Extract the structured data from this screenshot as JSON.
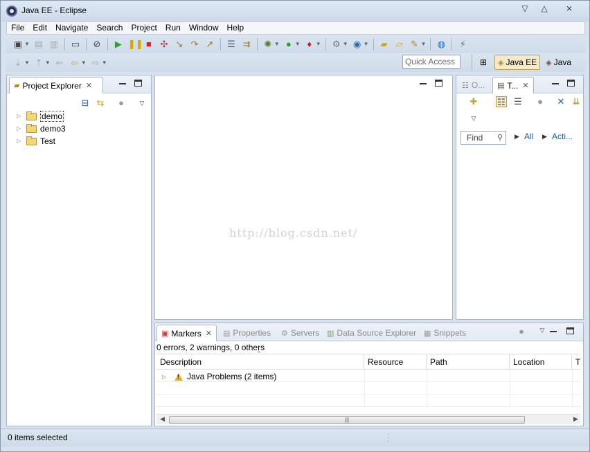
{
  "window": {
    "title": "Java EE - Eclipse",
    "controls": {
      "minimize": "▽",
      "maximize": "△",
      "close": "⨯"
    }
  },
  "menu": [
    "File",
    "Edit",
    "Navigate",
    "Search",
    "Project",
    "Run",
    "Window",
    "Help"
  ],
  "toolbar": {
    "quick_access": "Quick Access",
    "perspectives": [
      {
        "label": "Java EE",
        "icon": "java-ee-perspective-icon",
        "active": true
      },
      {
        "label": "Java",
        "icon": "java-perspective-icon",
        "active": false
      }
    ]
  },
  "project_explorer": {
    "tab_label": "Project Explorer",
    "items": [
      {
        "label": "demo",
        "selected": true
      },
      {
        "label": "demo3",
        "selected": false
      },
      {
        "label": "Test",
        "selected": false
      }
    ]
  },
  "editor": {
    "watermark": "http://blog.csdn.net/"
  },
  "side_panel": {
    "tabs": [
      "O...",
      "T..."
    ],
    "find_placeholder": "Find",
    "filter_all": "All",
    "filter_activate": "Acti..."
  },
  "bottom_panel": {
    "tabs": [
      {
        "label": "Markers",
        "active": true
      },
      {
        "label": "Properties",
        "active": false
      },
      {
        "label": "Servers",
        "active": false
      },
      {
        "label": "Data Source Explorer",
        "active": false
      },
      {
        "label": "Snippets",
        "active": false
      }
    ],
    "summary": "0 errors, 2 warnings, 0 others",
    "columns": [
      "Description",
      "Resource",
      "Path",
      "Location",
      "Ty"
    ],
    "rows": [
      {
        "description": "Java Problems (2 items)",
        "severity": "warning"
      }
    ]
  },
  "status": {
    "text": "0 items selected"
  },
  "colors": {
    "chrome": "#d8e2ee",
    "perspective_active": "#f4e9c8",
    "warning": "#e8b42c",
    "link": "#1f5aa5"
  }
}
